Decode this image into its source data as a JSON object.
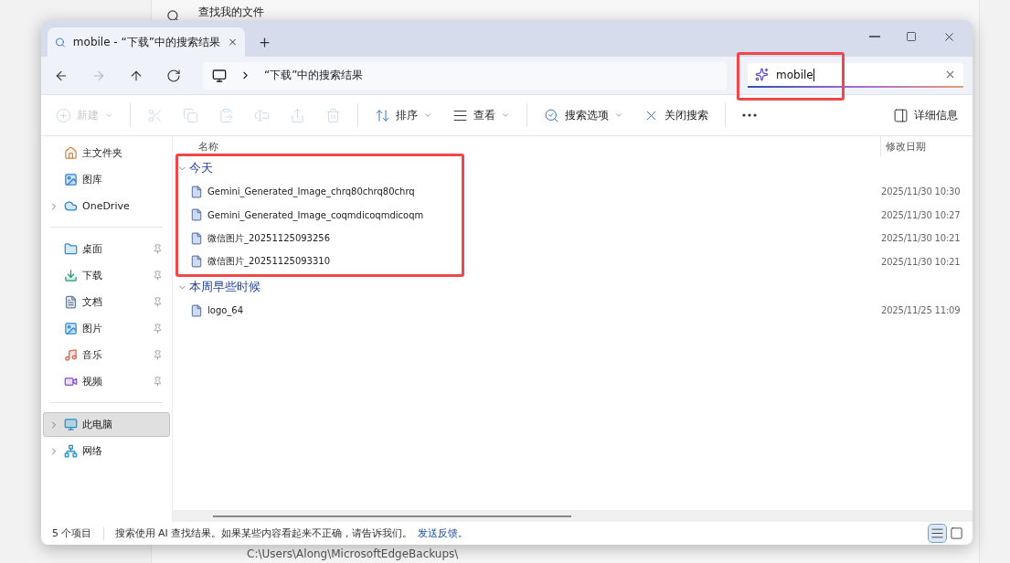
{
  "background": {
    "top_label": "查找我的文件",
    "bottom_path": "C:\\Users\\Along\\MicrosoftEdgeBackups\\"
  },
  "window": {
    "tab": {
      "title": "mobile - “下载”中的搜索结果"
    }
  },
  "navigation": [
    {
      "kind": "back",
      "disabled": false
    },
    {
      "kind": "forward",
      "disabled": true
    },
    {
      "kind": "up",
      "disabled": false
    },
    {
      "kind": "refresh",
      "disabled": false
    }
  ],
  "address_bar": {
    "path": "“下载”中的搜索结果"
  },
  "search": {
    "value": "mobile",
    "highlighted": true
  },
  "toolbar": [
    {
      "kind": "new",
      "label": "新建",
      "disabled": true,
      "dropdown": true
    },
    {
      "kind": "separator"
    },
    {
      "kind": "cut",
      "disabled": true
    },
    {
      "kind": "copy",
      "disabled": true
    },
    {
      "kind": "paste",
      "disabled": true
    },
    {
      "kind": "rename",
      "disabled": true
    },
    {
      "kind": "share",
      "disabled": true
    },
    {
      "kind": "delete",
      "disabled": true
    },
    {
      "kind": "separator"
    },
    {
      "kind": "sort",
      "label": "排序",
      "disabled": false,
      "dropdown": true
    },
    {
      "kind": "view",
      "label": "查看",
      "disabled": false,
      "dropdown": true
    },
    {
      "kind": "separator"
    },
    {
      "kind": "search_options",
      "label": "搜索选项",
      "disabled": false,
      "dropdown": true
    },
    {
      "kind": "close_search",
      "label": "关闭搜索",
      "disabled": false,
      "dropdown": false
    },
    {
      "kind": "separator"
    },
    {
      "kind": "more",
      "disabled": false
    },
    {
      "kind": "details",
      "label": "详细信息",
      "disabled": false,
      "dropdown": false
    }
  ],
  "sidebar": [
    [
      {
        "kind": "home",
        "label": "主文件夹",
        "expandable": false,
        "pinned": false,
        "selected": false
      },
      {
        "kind": "gallery",
        "label": "图库",
        "expandable": false,
        "pinned": false,
        "selected": false
      },
      {
        "kind": "cloud",
        "label": "OneDrive",
        "expandable": true,
        "pinned": false,
        "selected": false
      }
    ],
    [
      {
        "kind": "desktop",
        "label": "桌面",
        "expandable": false,
        "pinned": true,
        "selected": false
      },
      {
        "kind": "downloads",
        "label": "下载",
        "expandable": false,
        "pinned": true,
        "selected": false
      },
      {
        "kind": "documents",
        "label": "文档",
        "expandable": false,
        "pinned": true,
        "selected": false
      },
      {
        "kind": "pictures",
        "label": "图片",
        "expandable": false,
        "pinned": true,
        "selected": false
      },
      {
        "kind": "music",
        "label": "音乐",
        "expandable": false,
        "pinned": true,
        "selected": false
      },
      {
        "kind": "videos",
        "label": "视频",
        "expandable": false,
        "pinned": true,
        "selected": false
      }
    ],
    [
      {
        "kind": "pc",
        "label": "此电脑",
        "expandable": true,
        "pinned": false,
        "selected": true
      },
      {
        "kind": "network",
        "label": "网络",
        "expandable": true,
        "pinned": false,
        "selected": false
      }
    ]
  ],
  "files": {
    "columns": [
      "名称",
      "修改日期"
    ],
    "groups": [
      {
        "label": "今天",
        "expanded": true,
        "highlighted": true,
        "items": [
          {
            "name": "Gemini_Generated_Image_chrq80chrq80chrq",
            "date": "2025/11/30 10:30"
          },
          {
            "name": "Gemini_Generated_Image_coqmdicoqmdicoqm",
            "date": "2025/11/30 10:27"
          },
          {
            "name": "微信图片_20251125093256",
            "date": "2025/11/30 10:21"
          },
          {
            "name": "微信图片_20251125093310",
            "date": "2025/11/30 10:21"
          }
        ]
      },
      {
        "label": "本周早些时候",
        "expanded": true,
        "highlighted": false,
        "items": [
          {
            "name": "logo_64",
            "date": "2025/11/25 11:09"
          }
        ]
      }
    ]
  },
  "status_bar": {
    "count": "5 个项目",
    "message": "搜索使用 AI 查找结果。如果某些内容看起来不正确，请告诉我们。",
    "link": "发送反馈。",
    "views": [
      {
        "kind": "details",
        "selected": true
      },
      {
        "kind": "tiles",
        "selected": false
      }
    ]
  }
}
